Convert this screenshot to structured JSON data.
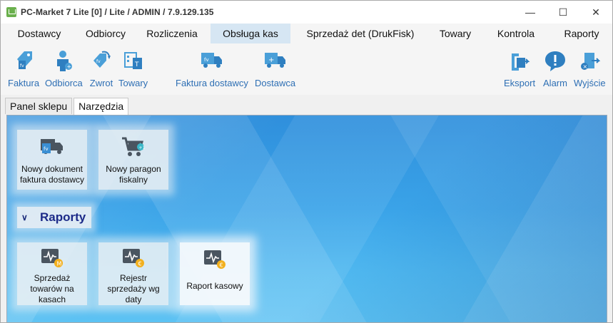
{
  "window": {
    "title": "PC-Market 7 Lite [0] / Lite / ADMIN / 7.9.129.135"
  },
  "menu": [
    {
      "label": "Dostawcy"
    },
    {
      "label": "Odbiorcy"
    },
    {
      "label": "Rozliczenia"
    },
    {
      "label": "Obsługa kas"
    },
    {
      "label": "Sprzedaż det (DrukFisk)"
    },
    {
      "label": "Towary"
    },
    {
      "label": "Kontrola"
    },
    {
      "label": "Raporty"
    }
  ],
  "toolbar": {
    "faktura": "Faktura",
    "odbiorca": "Odbiorca",
    "zwrot": "Zwrot",
    "towary": "Towary",
    "faktura_dostawcy": "Faktura dostawcy",
    "dostawca": "Dostawca",
    "eksport": "Eksport",
    "alarm": "Alarm",
    "wyjscie": "Wyjście"
  },
  "tabs": [
    {
      "label": "Panel sklepu"
    },
    {
      "label": "Narzędzia"
    }
  ],
  "tiles": {
    "nowy_dokument": "Nowy dokument faktura dostawcy",
    "nowy_paragon": "Nowy paragon fiskalny"
  },
  "section": {
    "title": "Raporty"
  },
  "report_tiles": {
    "sprzedaz": "Sprzedaż towarów na kasach",
    "rejestr": "Rejestr sprzedaży wg daty",
    "raport_kasowy": "Raport kasowy"
  },
  "colors": {
    "accent": "#2e6fb4",
    "icon_dark": "#4a5560",
    "coin": "#f2b01e",
    "menu_active": "#d6e6f3"
  }
}
